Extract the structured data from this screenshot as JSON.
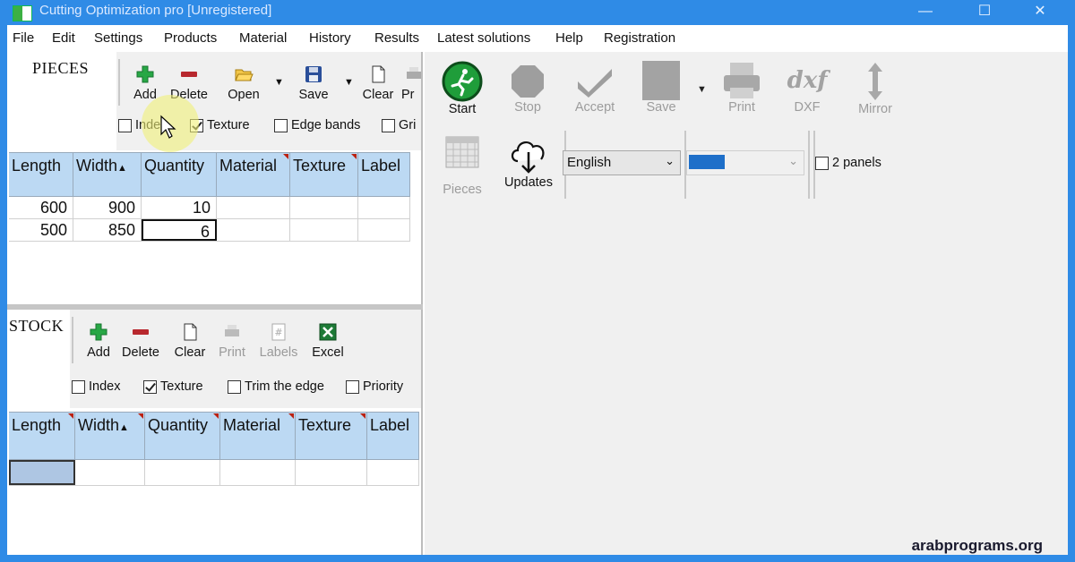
{
  "window": {
    "title": "Cutting Optimization pro [Unregistered]",
    "minimize": "—",
    "maximize": "☐",
    "close": "✕"
  },
  "menu": [
    "File",
    "Edit",
    "Settings",
    "Products",
    "Material",
    "History",
    "Results",
    "Latest solutions",
    "Help",
    "Registration"
  ],
  "pieces": {
    "label": "PIECES",
    "toolbar": {
      "add": "Add",
      "delete": "Delete",
      "open": "Open",
      "save": "Save",
      "clear": "Clear",
      "print": "Pr"
    },
    "checks": [
      {
        "label": "Index",
        "checked": false
      },
      {
        "label": "Texture",
        "checked": true
      },
      {
        "label": "Edge bands",
        "checked": false
      },
      {
        "label": "Gri",
        "checked": false
      }
    ],
    "columns": [
      "Length",
      "Width",
      "Quantity",
      "Material",
      "Texture",
      "Label"
    ],
    "rows": [
      [
        "600",
        "900",
        "10",
        "",
        "",
        ""
      ],
      [
        "500",
        "850",
        "6",
        "",
        "",
        ""
      ]
    ]
  },
  "stock": {
    "label": "STOCK",
    "toolbar": {
      "add": "Add",
      "delete": "Delete",
      "clear": "Clear",
      "print": "Print",
      "labels": "Labels",
      "excel": "Excel"
    },
    "checks": [
      {
        "label": "Index",
        "checked": false
      },
      {
        "label": "Texture",
        "checked": true
      },
      {
        "label": "Trim the edge",
        "checked": false
      },
      {
        "label": "Priority",
        "checked": false
      }
    ],
    "columns": [
      "Length",
      "Width",
      "Quantity",
      "Material",
      "Texture",
      "Label"
    ]
  },
  "right_toolbar": {
    "start": "Start",
    "stop": "Stop",
    "accept": "Accept",
    "save": "Save",
    "print": "Print",
    "dxf": "DXF",
    "dxf_icon_text": "dxf",
    "mirror": "Mirror",
    "pieces": "Pieces",
    "updates": "Updates",
    "language": "English",
    "two_panels": "2 panels"
  },
  "colors": {
    "title_bar": "#2f8be6",
    "grid_header": "#bcd9f3",
    "selected_cell": "#aec6e3",
    "start_green": "#1f9d3a"
  },
  "watermark": "arabprograms.org"
}
